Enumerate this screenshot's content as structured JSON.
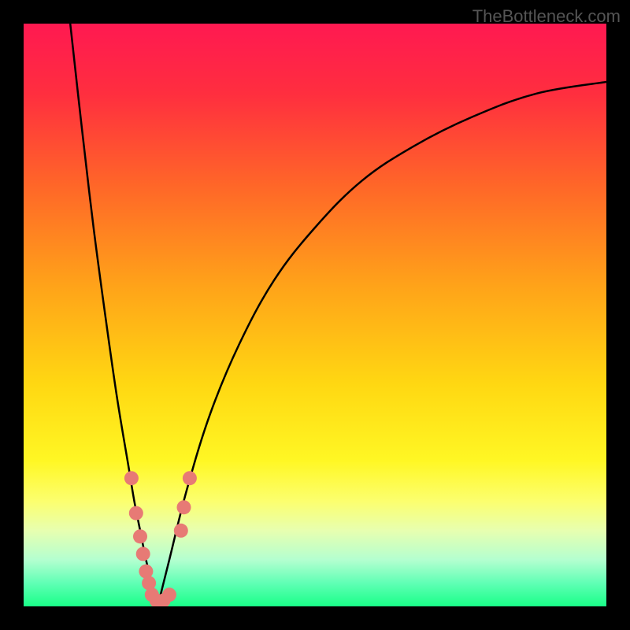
{
  "watermark": "TheBottleneck.com",
  "chart_data": {
    "type": "line",
    "title": "",
    "xlabel": "",
    "ylabel": "",
    "xlim": [
      0,
      100
    ],
    "ylim": [
      0,
      100
    ],
    "gradient_stops": [
      {
        "offset": 0,
        "color": "#ff1951"
      },
      {
        "offset": 12,
        "color": "#ff2e3f"
      },
      {
        "offset": 28,
        "color": "#ff6728"
      },
      {
        "offset": 45,
        "color": "#ffa319"
      },
      {
        "offset": 62,
        "color": "#ffd812"
      },
      {
        "offset": 75,
        "color": "#fff724"
      },
      {
        "offset": 82,
        "color": "#fcff6f"
      },
      {
        "offset": 87,
        "color": "#e7ffb0"
      },
      {
        "offset": 92,
        "color": "#b4ffd0"
      },
      {
        "offset": 96,
        "color": "#60ffb5"
      },
      {
        "offset": 100,
        "color": "#19ff88"
      }
    ],
    "series": [
      {
        "name": "left-curve",
        "color": "#000000",
        "x": [
          8,
          10,
          12,
          14,
          16,
          18,
          19,
          20,
          21,
          22,
          23
        ],
        "y": [
          100,
          82,
          65,
          50,
          36,
          24,
          18,
          13,
          8,
          4,
          0
        ]
      },
      {
        "name": "right-curve",
        "color": "#000000",
        "x": [
          23,
          25,
          28,
          32,
          37,
          43,
          50,
          58,
          67,
          77,
          88,
          100
        ],
        "y": [
          0,
          8,
          20,
          33,
          45,
          56,
          65,
          73,
          79,
          84,
          88,
          90
        ]
      }
    ],
    "markers": {
      "color": "#e77a75",
      "radius": 9,
      "points": [
        {
          "x": 18.5,
          "y": 22
        },
        {
          "x": 19.3,
          "y": 16
        },
        {
          "x": 20,
          "y": 12
        },
        {
          "x": 20.5,
          "y": 9
        },
        {
          "x": 21,
          "y": 6
        },
        {
          "x": 21.5,
          "y": 4
        },
        {
          "x": 22,
          "y": 2
        },
        {
          "x": 22.8,
          "y": 1
        },
        {
          "x": 24,
          "y": 1
        },
        {
          "x": 25,
          "y": 2
        },
        {
          "x": 27,
          "y": 13
        },
        {
          "x": 27.5,
          "y": 17
        },
        {
          "x": 28.5,
          "y": 22
        }
      ]
    }
  }
}
